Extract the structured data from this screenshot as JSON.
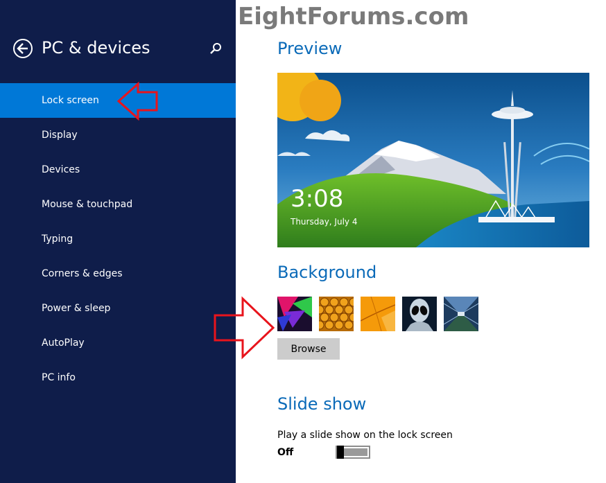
{
  "watermark": "EightForums.com",
  "sidebar": {
    "title": "PC & devices",
    "items": [
      {
        "label": "Lock screen",
        "active": true
      },
      {
        "label": "Display"
      },
      {
        "label": "Devices"
      },
      {
        "label": "Mouse & touchpad"
      },
      {
        "label": "Typing"
      },
      {
        "label": "Corners & edges"
      },
      {
        "label": "Power & sleep"
      },
      {
        "label": "AutoPlay"
      },
      {
        "label": "PC info"
      }
    ]
  },
  "preview": {
    "heading": "Preview",
    "time": "3:08",
    "date": "Thursday, July 4"
  },
  "background": {
    "heading": "Background",
    "thumbnails": [
      "abstract-pink-green",
      "honeycomb",
      "orange-leaf",
      "alien",
      "tunnel"
    ],
    "browse_label": "Browse"
  },
  "slideshow": {
    "heading": "Slide show",
    "description": "Play a slide show on the lock screen",
    "state": "Off"
  },
  "colors": {
    "sidebar_bg": "#0f1d4a",
    "accent": "#0078d7",
    "heading": "#0a6ab8",
    "annotation": "#e8141c"
  }
}
